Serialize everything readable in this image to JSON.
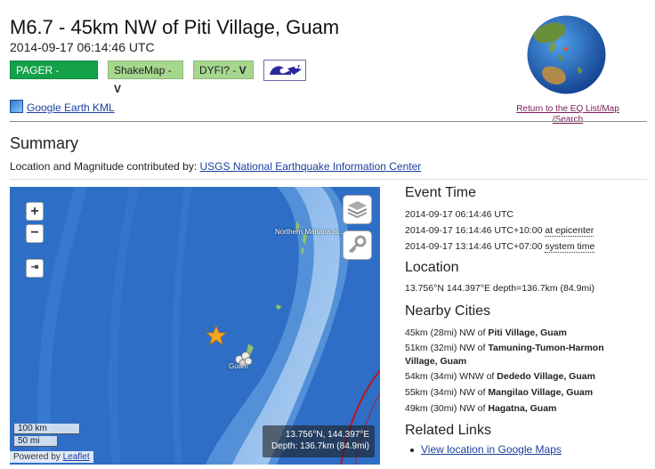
{
  "header": {
    "title": "M6.7 - 45km NW of Piti Village, Guam",
    "datetime": "2014-09-17 06:14:46 UTC"
  },
  "badges": {
    "pager_label": "PAGER - ",
    "pager_level": "GREEN",
    "pager_color": "#13a14a",
    "shakemap_label": "ShakeMap - ",
    "shakemap_level": "V",
    "dyfi_label": "DYFI? - ",
    "dyfi_level": "V",
    "intensity_color": "#a6d78e",
    "tsunami_icon": "tsunami-wave-icon"
  },
  "links": {
    "kml": "Google Earth KML",
    "eq_list": "Return to the EQ List/Map /Search"
  },
  "summary": {
    "heading": "Summary",
    "contrib_prefix": "Location and Magnitude contributed by: ",
    "contrib_link": "USGS National Earthquake Information Center"
  },
  "map": {
    "label_islands": "Northern Mariana Is...",
    "label_guam": "Guam",
    "scale_km": "100 km",
    "scale_mi": "50 mi",
    "attrib_prefix": "Powered by ",
    "attrib_link": "Leaflet",
    "coord_line1": "13.756°N, 144.397°E",
    "coord_line2": "Depth: 136.7km (84.9mi)",
    "zoom_in": "+",
    "zoom_out": "−",
    "fullscreen": "⇥",
    "ocean_color": "#2e6ec6",
    "epicenter_color": "#f4a623"
  },
  "event_time": {
    "heading": "Event Time",
    "utc": "2014-09-17 06:14:46 UTC",
    "epicenter_time": "2014-09-17 16:14:46 UTC+10:00 ",
    "epicenter_label": "at epicenter",
    "system_time": "2014-09-17 13:14:46 UTC+07:00 ",
    "system_label": "system time"
  },
  "location": {
    "heading": "Location",
    "value": "13.756°N 144.397°E depth=136.7km (84.9mi)"
  },
  "nearby": {
    "heading": "Nearby Cities",
    "cities": [
      {
        "dist": "45km (28mi) NW of ",
        "name": "Piti Village, Guam"
      },
      {
        "dist": "51km (32mi) NW of ",
        "name": "Tamuning-Tumon-Harmon"
      },
      {
        "dist": "",
        "name": "Village, Guam"
      },
      {
        "dist": "54km (34mi) WNW of ",
        "name": "Dededo Village, Guam"
      },
      {
        "dist": "55km (34mi) NW of ",
        "name": "Mangilao Village, Guam"
      },
      {
        "dist": "49km (30mi) NW of ",
        "name": "Hagatna, Guam"
      }
    ]
  },
  "related": {
    "heading": "Related Links",
    "maps_link": "View location in Google Maps"
  }
}
